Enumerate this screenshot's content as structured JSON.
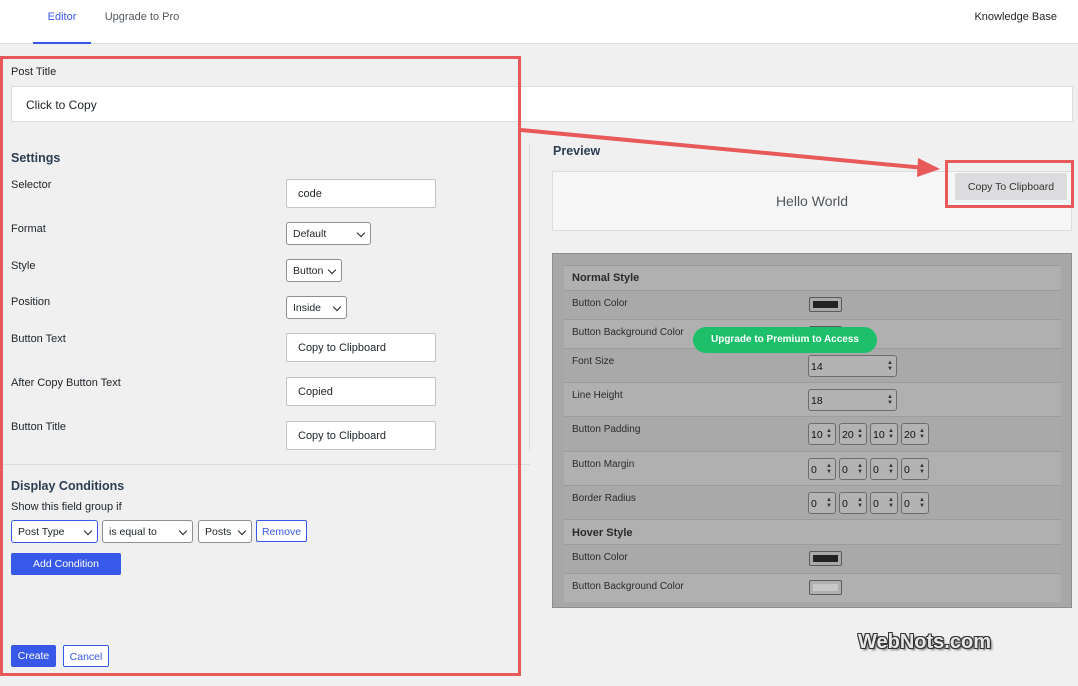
{
  "tabs": [
    {
      "label": "Editor",
      "active": true
    },
    {
      "label": "Upgrade to Pro",
      "active": false
    }
  ],
  "header_right_link": "Knowledge Base",
  "post_title": {
    "label": "Post Title",
    "value": "Click to Copy"
  },
  "settings": {
    "title": "Settings",
    "selector": {
      "label": "Selector",
      "value": "code"
    },
    "format": {
      "label": "Format",
      "value": "Default"
    },
    "style": {
      "label": "Style",
      "value": "Button"
    },
    "position": {
      "label": "Position",
      "value": "Inside"
    },
    "button_text": {
      "label": "Button Text",
      "value": "Copy to Clipboard"
    },
    "after_copy_text": {
      "label": "After Copy Button Text",
      "value": "Copied"
    },
    "button_title": {
      "label": "Button Title",
      "value": "Copy to Clipboard"
    }
  },
  "display_conditions": {
    "title": "Display Conditions",
    "subtitle": "Show this field group if",
    "field_select": "Post Type",
    "operator_select": "is equal to",
    "value_select": "Posts",
    "remove_label": "Remove",
    "add_condition_label": "Add Condition"
  },
  "footer": {
    "create_label": "Create",
    "cancel_label": "Cancel"
  },
  "preview": {
    "title": "Preview",
    "sample_text": "Hello World",
    "copy_button_label": "Copy To Clipboard"
  },
  "style_panel": {
    "normal_title": "Normal Style",
    "hover_title": "Hover Style",
    "normal_rows": {
      "button_color": {
        "label": "Button Color",
        "color": "#222222"
      },
      "button_bg_color": {
        "label": "Button Background Color",
        "color": "#d0d0d0"
      },
      "font_size": {
        "label": "Font Size",
        "value": "14"
      },
      "line_height": {
        "label": "Line Height",
        "value": "18"
      },
      "button_padding": {
        "label": "Button Padding",
        "values": [
          "10",
          "20",
          "10",
          "20"
        ]
      },
      "button_margin": {
        "label": "Button Margin",
        "values": [
          "0",
          "0",
          "0",
          "0"
        ]
      },
      "border_radius": {
        "label": "Border Radius",
        "values": [
          "0",
          "0",
          "0",
          "0"
        ]
      }
    },
    "hover_rows": {
      "button_color": {
        "label": "Button Color",
        "color": "#222222"
      },
      "button_bg_color": {
        "label": "Button Background Color",
        "color": "#c8c8c8"
      }
    }
  },
  "upgrade_overlay": "Upgrade to Premium to Access",
  "watermark": "WebNots.com",
  "colors": {
    "accent": "#3858e9",
    "highlight": "#e8595a",
    "upgrade": "#1dbf6a"
  }
}
